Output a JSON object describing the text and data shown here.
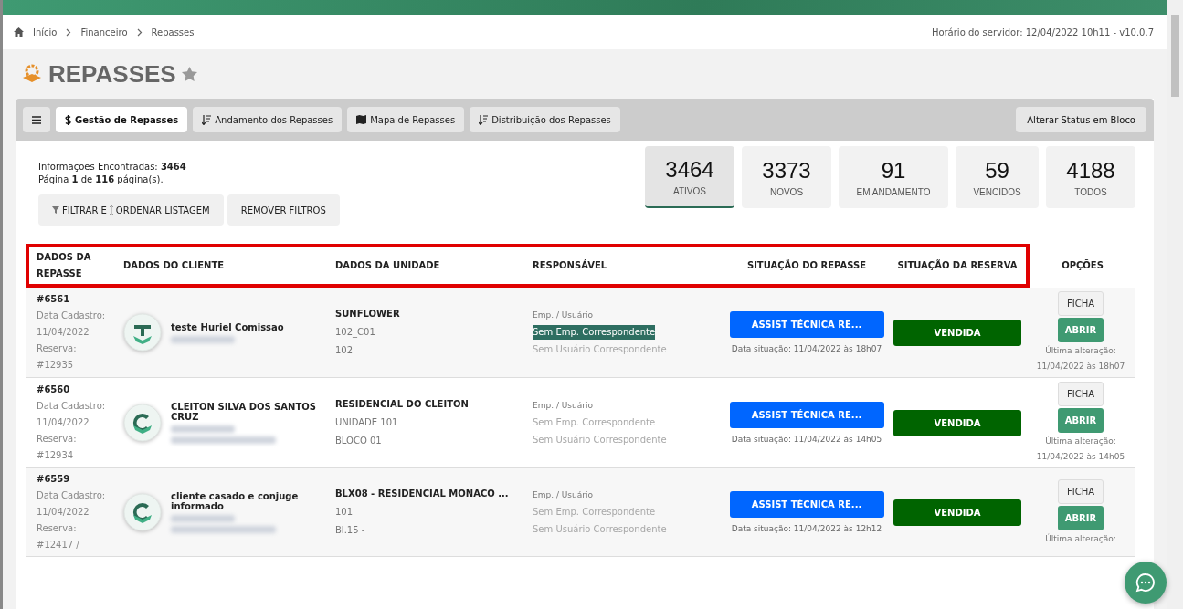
{
  "breadcrumbs": [
    {
      "label": "Início",
      "kind": "home"
    },
    {
      "label": "Financeiro",
      "kind": "plain"
    },
    {
      "label": "Repasses",
      "kind": "plain"
    }
  ],
  "server_time": "Horário do servidor: 12/04/2022 10h11 - v10.0.7",
  "title": "REPASSES",
  "tabs": [
    {
      "kind": "menu",
      "selected": false
    },
    {
      "kind": "dollar",
      "label": "Gestão de Repasses",
      "selected": true
    },
    {
      "kind": "sort",
      "label": "Andamento dos Repasses",
      "selected": false
    },
    {
      "kind": "map",
      "label": "Mapa de Repasses",
      "selected": false
    },
    {
      "kind": "sort",
      "label": "Distribuição dos Repasses",
      "selected": false
    }
  ],
  "bulk_button": "Alterar Status em Bloco",
  "info": [
    "Informações Encontradas: **3464**",
    "Página **1** de **116** página(s)."
  ],
  "filter_button": {
    "before": "FILTRAR E",
    "after": "ORDENAR LISTAGEM"
  },
  "remove_button": "REMOVER FILTROS",
  "stats": [
    {
      "value": "3464",
      "label": "ATIVOS",
      "selected": true
    },
    {
      "value": "3373",
      "label": "NOVOS",
      "selected": false
    },
    {
      "value": "91",
      "label": "EM ANDAMENTO",
      "selected": false
    },
    {
      "value": "59",
      "label": "VENCIDOS",
      "selected": false
    },
    {
      "value": "4188",
      "label": "TODOS",
      "selected": false
    }
  ],
  "columns": [
    "DADOS DA REPASSE",
    "DADOS DO CLIENTE",
    "DADOS DA UNIDADE",
    "RESPONSÁVEL",
    "SITUAÇÃO DO REPASSE",
    "SITUAÇÃO DA RESERVA",
    "OPÇÕES"
  ],
  "rows": [
    {
      "id": "#6561",
      "registered_label": "Data Cadastro:",
      "registered": "11/04/2022",
      "reservation_label": "Reserva:",
      "reservation": "#12935",
      "client": "teste Huriel Comissao",
      "unit": [
        "SUNFLOWER",
        "102_C01",
        "102"
      ],
      "resp_label": "Emp. / Usuário",
      "emp": "Sem Emp. Correspondente",
      "emp_highlighted": true,
      "user": "Sem Usuário Correspondente",
      "status": "ASSIST TÉCNICA RE...",
      "status_date": "Data situação: 11/04/2022 às 18h07",
      "reserve_status": "VENDIDA",
      "ficha": "FICHA",
      "abrir": "ABRIR",
      "changed_label": "Última alteração:",
      "changed": "11/04/2022 às 18h07"
    },
    {
      "id": "#6560",
      "registered_label": "Data Cadastro:",
      "registered": "11/04/2022",
      "reservation_label": "Reserva:",
      "reservation": "#12934",
      "client": "CLEITON SILVA DOS SANTOS CRUZ",
      "unit": [
        "RESIDENCIAL DO CLEITON",
        "UNIDADE 101",
        "BLOCO 01"
      ],
      "resp_label": "Emp. / Usuário",
      "emp": "Sem Emp. Correspondente",
      "emp_highlighted": false,
      "user": "Sem Usuário Correspondente",
      "status": "ASSIST TÉCNICA RE...",
      "status_date": "Data situação: 11/04/2022 às 14h05",
      "reserve_status": "VENDIDA",
      "ficha": "FICHA",
      "abrir": "ABRIR",
      "changed_label": "Última alteração:",
      "changed": "11/04/2022 às 14h05"
    },
    {
      "id": "#6559",
      "registered_label": "Data Cadastro:",
      "registered": "11/04/2022",
      "reservation_label": "Reserva:",
      "reservation": "#12417 /",
      "client": "cliente casado e conjuge informado",
      "unit": [
        "BLX08 - RESIDENCIAL MONACO ...",
        "101",
        "Bl.15 -"
      ],
      "resp_label": "Emp. / Usuário",
      "emp": "Sem Emp. Correspondente",
      "emp_highlighted": false,
      "user": "Sem Usuário Correspondente",
      "status": "ASSIST TÉCNICA RE...",
      "status_date": "Data situação: 11/04/2022 às 12h12",
      "reserve_status": "VENDIDA",
      "ficha": "FICHA",
      "abrir": "ABRIR",
      "changed_label": "Última alteração:"
    }
  ]
}
